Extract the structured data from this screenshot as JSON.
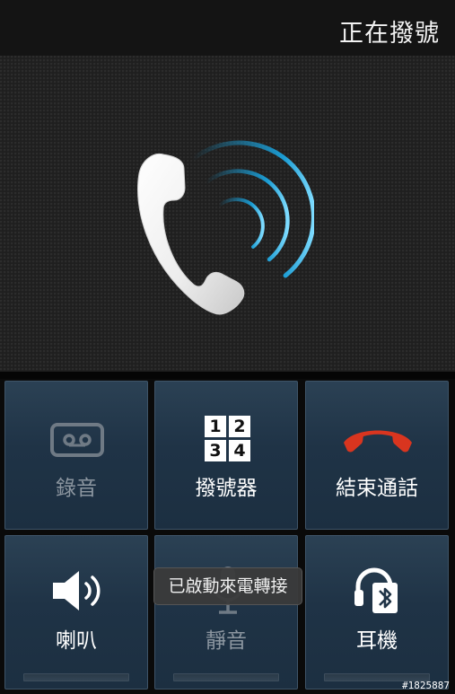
{
  "status": {
    "title": "正在撥號"
  },
  "buttons": {
    "record": {
      "label": "錄音",
      "icon": "cassette-icon",
      "enabled": false
    },
    "dialpad": {
      "label": "撥號器",
      "icon": "dialpad-icon",
      "keys": [
        "1",
        "2",
        "3",
        "4"
      ],
      "enabled": true
    },
    "end_call": {
      "label": "結束通話",
      "icon": "end-call-icon",
      "enabled": true
    },
    "speaker": {
      "label": "喇叭",
      "icon": "speaker-icon",
      "enabled": true
    },
    "mute": {
      "label": "靜音",
      "icon": "microphone-icon",
      "enabled": false
    },
    "headset": {
      "label": "耳機",
      "icon": "bluetooth-headset-icon",
      "enabled": true
    }
  },
  "toast": {
    "text": "已啟動來電轉接"
  },
  "watermark": {
    "text": "#1825887"
  },
  "colors": {
    "accent_blue": "#1aa9e6",
    "end_call_red": "#d9351f",
    "tile_bg": "#1f3346"
  }
}
